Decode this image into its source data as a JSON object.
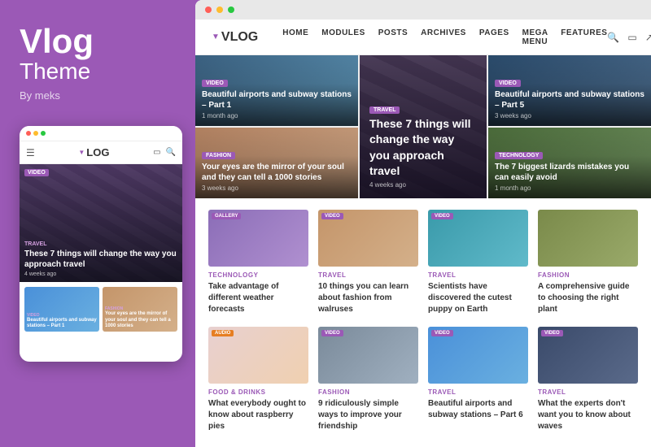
{
  "left": {
    "brand_name": "Vlog",
    "brand_subtitle": "Theme",
    "brand_by": "By meks"
  },
  "browser": {
    "dots": [
      "red",
      "yellow",
      "green"
    ]
  },
  "header": {
    "logo": "VLOG",
    "nav": [
      "HOME",
      "MODULES",
      "POSTS",
      "ARCHIVES",
      "PAGES",
      "MEGA MENU",
      "FEATURES"
    ]
  },
  "hero": {
    "left_card": {
      "tag": "VIDEO",
      "title": "Beautiful airports and subway stations – Part 1",
      "date": "1 month ago"
    },
    "center_card": {
      "tag": "TRAVEL",
      "title": "These 7 things will change the way you approach travel",
      "date": "4 weeks ago"
    },
    "right_top": {
      "tag": "VIDEO",
      "title": "Beautiful airports and subway stations – Part 5",
      "date": "3 weeks ago"
    },
    "right_bottom": {
      "tag": "TECHNOLOGY",
      "title": "The 7 biggest lizards mistakes you can easily avoid",
      "date": "1 month ago"
    },
    "left_bottom": {
      "tag": "FASHION",
      "title": "Your eyes are the mirror of your soul and they can tell a 1000 stories",
      "date": "3 weeks ago"
    }
  },
  "grid_row1": [
    {
      "cat": "TECHNOLOGY",
      "title": "Take advantage of different weather forecasts",
      "tag": "GALLERY",
      "tag_color": "purple"
    },
    {
      "cat": "TRAVEL",
      "title": "10 things you can learn about fashion from walruses",
      "tag": "VIDEO",
      "tag_color": "purple"
    },
    {
      "cat": "TRAVEL",
      "title": "Scientists have discovered the cutest puppy on Earth",
      "tag": "VIDEO",
      "tag_color": "purple"
    },
    {
      "cat": "FASHION",
      "title": "A comprehensive guide to choosing the right plant",
      "tag": "",
      "tag_color": ""
    }
  ],
  "grid_row2": [
    {
      "cat": "FOOD & DRINKS",
      "title": "What everybody ought to know about raspberry pies",
      "tag": "AUDIO",
      "tag_color": "orange"
    },
    {
      "cat": "FASHION",
      "title": "9 ridiculously simple ways to improve your friendship",
      "tag": "VIDEO",
      "tag_color": "purple"
    },
    {
      "cat": "TRAVEL",
      "title": "Beautiful airports and subway stations – Part 6",
      "tag": "VIDEO",
      "tag_color": "purple"
    },
    {
      "cat": "TRAVEL",
      "title": "What the experts don't want you to know about waves",
      "tag": "VIDEO",
      "tag_color": "purple"
    }
  ],
  "mobile": {
    "hero_tag": "VIDEO",
    "hero_cat": "TRAVEL",
    "hero_title": "These 7 things will change the way you approach travel",
    "hero_date": "4 weeks ago",
    "thumb1_cat": "VIDEO",
    "thumb1_title": "Beautiful airports and subway stations – Part 1",
    "thumb2_cat": "FASHION",
    "thumb2_title": "Your eyes are the mirror of your soul and they can tell a 1000 stories"
  }
}
